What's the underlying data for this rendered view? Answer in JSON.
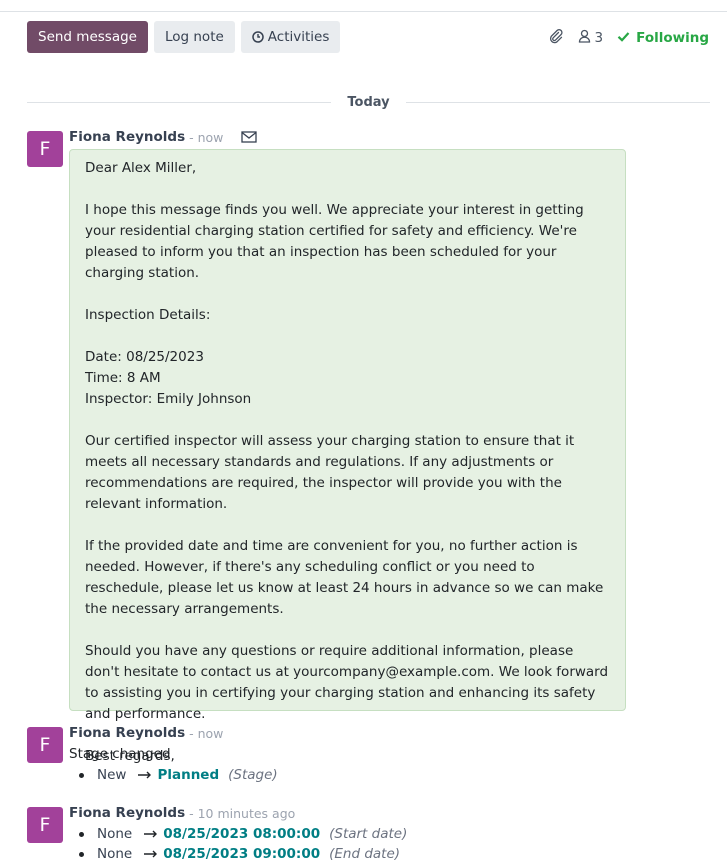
{
  "toolbar": {
    "send_message": "Send message",
    "log_note": "Log note",
    "activities": "Activities"
  },
  "right_tools": {
    "follower_count": "3",
    "following": "Following"
  },
  "separator": {
    "label": "Today"
  },
  "messages": [
    {
      "avatar": "F",
      "author": "Fiona Reynolds",
      "time": "- now",
      "body": [
        "Dear Alex Miller,",
        "",
        "I hope this message finds you well. We appreciate your interest in getting your residential charging station certified for safety and efficiency. We're pleased to inform you that an inspection has been scheduled for your charging station.",
        "",
        "Inspection Details:",
        "",
        "Date: 08/25/2023",
        "Time: 8 AM",
        "Inspector: Emily Johnson",
        "",
        "Our certified inspector will assess your charging station to ensure that it meets all necessary standards and regulations. If any adjustments or recommendations are required, the inspector will provide you with the relevant information.",
        "",
        "If the provided date and time are convenient for you, no further action is needed. However, if there's any scheduling conflict or you need to reschedule, please let us know at least 24 hours in advance so we can make the necessary arrangements.",
        "",
        "Should you have any questions or require additional information, please don't hesitate to contact us at yourcompany@example.com. We look forward to assisting you in certifying your charging station and enhancing its safety and performance.",
        "",
        "Best regards,"
      ]
    },
    {
      "avatar": "F",
      "author": "Fiona Reynolds",
      "time": "- now",
      "note": "Stage changed",
      "tracking": [
        {
          "old": "New",
          "new": "Planned",
          "field": "(Stage)"
        }
      ]
    },
    {
      "avatar": "F",
      "author": "Fiona Reynolds",
      "time": "- 10 minutes ago",
      "tracking": [
        {
          "old": "None",
          "new": "08/25/2023 08:00:00",
          "field": "(Start date)"
        },
        {
          "old": "None",
          "new": "08/25/2023 09:00:00",
          "field": "(End date)"
        }
      ]
    }
  ],
  "colors": {
    "primary": "#714b67",
    "avatar": "#a2419a",
    "following": "#28a745",
    "bubble_bg": "#e6f1e3",
    "tracking_link": "#017e84"
  }
}
